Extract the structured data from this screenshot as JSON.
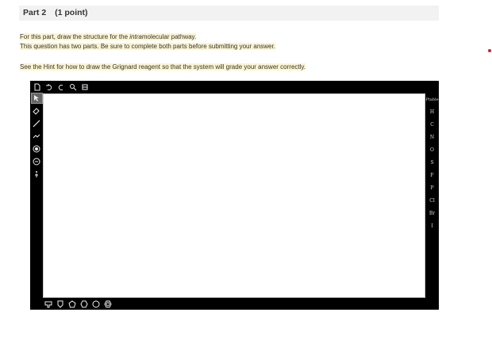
{
  "header": {
    "part": "Part 2",
    "points": "(1 point)"
  },
  "instructions": {
    "line1_prefix": "For this part, draw the structure for the ",
    "line1_italic": "intra",
    "line1_suffix": "molecular pathway.",
    "line2": "This question has two parts. Be sure to complete both parts before submitting your answer.",
    "line3": "See the Hint for how to draw the Grignard reagent so that the system will grade your answer correctly."
  },
  "editor": {
    "top_tools": [
      "new-document-icon",
      "undo-icon",
      "redo-icon",
      "zoom-icon",
      "template-icon"
    ],
    "left_tools": [
      "select-icon",
      "eraser-icon",
      "single-bond-icon",
      "chain-icon",
      "positive-charge-icon",
      "negative-charge-icon",
      "radical-icon"
    ],
    "periodic_label": "Ptable",
    "elements": [
      "H",
      "C",
      "N",
      "O",
      "S",
      "F",
      "P",
      "Cl",
      "Br",
      "I"
    ],
    "bottom_tools": [
      "custom-template-icon",
      "pentagon-icon",
      "hexagon-icon",
      "circle-ring-icon",
      "benzene-icon"
    ]
  }
}
